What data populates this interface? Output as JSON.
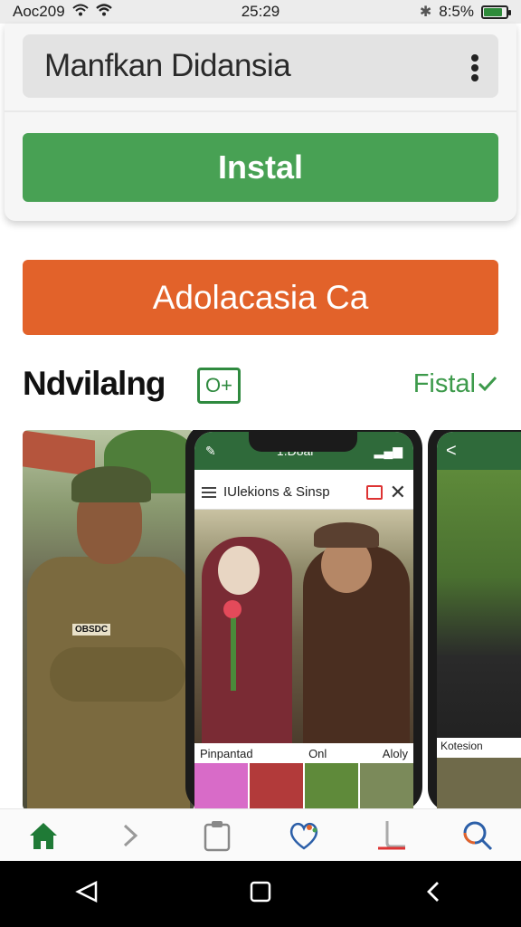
{
  "status_bar": {
    "left_text": "Aoc209",
    "time": "25:29",
    "battery_text": "8:5%"
  },
  "app_bar": {
    "title": "Manfkan Didansia"
  },
  "install_button": {
    "label": "Instal"
  },
  "orange_button": {
    "label": "Adolacasia Ca"
  },
  "section": {
    "title": "Ndvilalng",
    "badge": "O+",
    "link": "Fistal"
  },
  "gallery": {
    "shot1": {
      "badge": "OBSDC"
    },
    "phone": {
      "status_text": "1.D8al",
      "search_text": "IUlekions & Sinsp",
      "labels": [
        "Pinpantad",
        "Onl",
        "Aloly"
      ]
    },
    "phone2": {
      "back_glyph": "<",
      "label": "Kotesion"
    }
  },
  "bottom_nav": {
    "items": [
      "home-icon",
      "chevron-right-icon",
      "clipboard-icon",
      "heart-icon",
      "tools-icon",
      "search-icon"
    ]
  },
  "colors": {
    "green": "#48a154",
    "orange": "#e2622a",
    "dark_green": "#2f6a3a"
  }
}
